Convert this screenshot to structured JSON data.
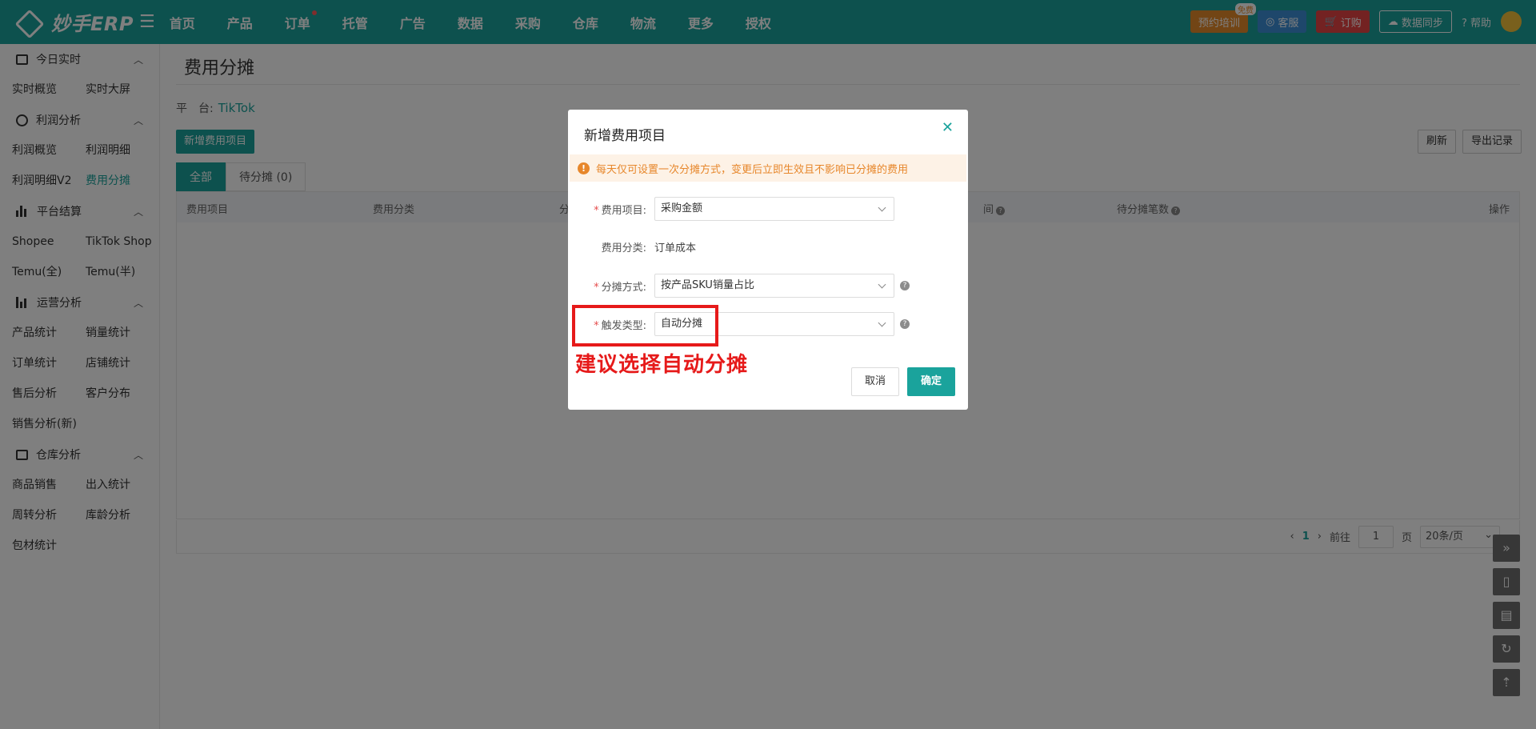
{
  "brand": {
    "logo_text": "妙手ERP"
  },
  "nav": [
    "首页",
    "产品",
    "订单",
    "托管",
    "广告",
    "数据",
    "采购",
    "仓库",
    "物流",
    "更多",
    "授权"
  ],
  "topbar": {
    "train": "预约培训",
    "train_badge": "免费",
    "service": "客服",
    "order": "订购",
    "sync": "数据同步",
    "help": "帮助"
  },
  "sidebar": {
    "sections": [
      {
        "title": "今日实时",
        "items": [
          "实时概览",
          "实时大屏"
        ]
      },
      {
        "title": "利润分析",
        "items": [
          "利润概览",
          "利润明细",
          "利润明细V2",
          "费用分摊"
        ]
      },
      {
        "title": "平台结算",
        "items": [
          "Shopee",
          "TikTok Shop",
          "Temu(全)",
          "Temu(半)"
        ]
      },
      {
        "title": "运营分析",
        "items": [
          "产品统计",
          "销量统计",
          "订单统计",
          "店铺统计",
          "售后分析",
          "客户分布",
          "销售分析(新)"
        ]
      },
      {
        "title": "仓库分析",
        "items": [
          "商品销售",
          "出入统计",
          "周转分析",
          "库龄分析",
          "包材统计"
        ]
      }
    ]
  },
  "page": {
    "title": "费用分摊",
    "platform_label": "平　台:",
    "platform_value": "TikTok",
    "add_button": "新增费用项目",
    "refresh": "刷新",
    "export": "导出记录",
    "tabs": [
      "全部",
      "待分摊 (0)"
    ],
    "columns": [
      "费用项目",
      "费用分类",
      "分",
      "间",
      "待分摊笔数",
      "操作"
    ],
    "pager": {
      "current": "1",
      "goto": "前往",
      "page_input": "1",
      "page_unit": "页",
      "size": "20条/页"
    }
  },
  "modal": {
    "title": "新增费用项目",
    "warning": "每天仅可设置一次分摊方式，变更后立即生效且不影响已分摊的费用",
    "fee_item_label": "费用项目:",
    "fee_item_value": "采购金额",
    "fee_category_label": "费用分类:",
    "fee_category_value": "订单成本",
    "method_label": "分摊方式:",
    "method_value": "按产品SKU销量占比",
    "trigger_label": "触发类型:",
    "trigger_value": "自动分摊",
    "annotation": "建议选择自动分摊",
    "cancel": "取消",
    "confirm": "确定"
  }
}
